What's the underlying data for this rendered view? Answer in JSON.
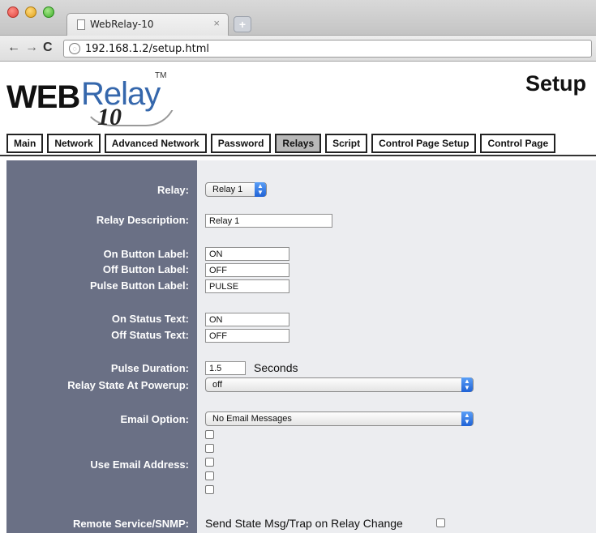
{
  "browser": {
    "tab_title": "WebRelay-10",
    "tab_close": "×",
    "newtab": "+",
    "url": "192.168.1.2/setup.html"
  },
  "header": {
    "logo_web": "WEB",
    "logo_relay": "Relay",
    "logo_tm": "TM",
    "logo_10": "10",
    "title": "Setup"
  },
  "menu": [
    "Main",
    "Network",
    "Advanced Network",
    "Password",
    "Relays",
    "Script",
    "Control Page Setup",
    "Control Page"
  ],
  "menu_active": "Relays",
  "form": {
    "relay_label": "Relay:",
    "relay_value": "Relay 1",
    "description_label": "Relay Description:",
    "description_value": "Relay 1",
    "on_button_label": "On Button Label:",
    "on_button_value": "ON",
    "off_button_label": "Off Button Label:",
    "off_button_value": "OFF",
    "pulse_button_label": "Pulse Button Label:",
    "pulse_button_value": "PULSE",
    "on_status_label": "On Status Text:",
    "on_status_value": "ON",
    "off_status_label": "Off Status Text:",
    "off_status_value": "OFF",
    "pulse_duration_label": "Pulse Duration:",
    "pulse_duration_value": "1.5",
    "pulse_duration_unit": "Seconds",
    "powerup_label": "Relay State At Powerup:",
    "powerup_value": "off",
    "email_option_label": "Email Option:",
    "email_option_value": "No Email Messages",
    "use_email_label": "Use Email Address:",
    "remote_service_label": "Remote Service/SNMP:",
    "remote_service_text": "Send State Msg/Trap on Relay Change"
  },
  "colors": {
    "label_panel": "#6a7085",
    "value_panel": "#ecedf0",
    "logo_relay": "#3567ac"
  }
}
